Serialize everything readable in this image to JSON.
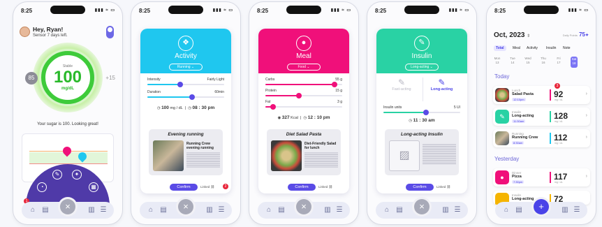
{
  "status": {
    "time": "8:25",
    "signal": "▮▮▮ ≈ ▭"
  },
  "home": {
    "greeting": "Hey, Ryan!",
    "subtitle": "Sensor 7 days left.",
    "ring_label": "Stable",
    "value": "100",
    "unit": "mg/dL",
    "low": "85",
    "delta": "+15",
    "message": "Your sugar is 100. Looking great!",
    "badge": "1"
  },
  "activity": {
    "title": "Activity",
    "type": "Running",
    "color": "#1fc7ef",
    "sliders": [
      {
        "name": "Intensity",
        "value": "Fairly Light",
        "pct": 0.43
      },
      {
        "name": "Duration",
        "value": "60min",
        "pct": 0.58
      }
    ],
    "stat_value": "100",
    "stat_unit": "mg / dL",
    "time": "08 : 30 pm",
    "post_title": "Evening running",
    "post_heading": "Running Crew evening running",
    "confirm": "Confirm",
    "linked": "Linked",
    "linked_count": "2"
  },
  "meal": {
    "title": "Meal",
    "type": "Food",
    "color": "#f0107a",
    "sliders": [
      {
        "name": "Carbs",
        "value": "55 g",
        "pct": 0.9
      },
      {
        "name": "Protein",
        "value": "15 g",
        "pct": 0.44
      },
      {
        "name": "Fat",
        "value": "3 g",
        "pct": 0.1
      }
    ],
    "stat_value": "327",
    "stat_unit": "Kcal",
    "time": "12 : 10 pm",
    "post_title": "Diet Salad Pasta",
    "post_heading": "Diet-Friendly Salad for lunch",
    "confirm": "Confirm",
    "linked": "Linked"
  },
  "insulin": {
    "title": "Insulin",
    "type": "Long-acting",
    "color": "#29d2a4",
    "opt_fast": "Fast-acting",
    "opt_long": "Long-acting",
    "units_label": "Insulin units",
    "units_value": "5 UI",
    "units_pct": 0.55,
    "time": "11 : 30 am",
    "post_title": "Long-acting Insulin",
    "confirm": "Confirm",
    "linked": "Linked"
  },
  "log": {
    "month": "Oct, 2023",
    "points": "75",
    "points_label": "Daily Points",
    "filters": [
      "Total",
      "Meal",
      "Activity",
      "Insulin",
      "Note"
    ],
    "days": [
      {
        "dow": "Mon",
        "num": "13"
      },
      {
        "dow": "Tue",
        "num": "14"
      },
      {
        "dow": "Wed",
        "num": "15"
      },
      {
        "dow": "Thu",
        "num": "16"
      },
      {
        "dow": "Fri",
        "num": "17"
      },
      {
        "dow": "Sat",
        "num": "18"
      }
    ],
    "today": "Today",
    "yesterday": "Yesterday",
    "entries": [
      {
        "cat": "Lunch",
        "name": "Salad Pasta",
        "time": "12:10pm",
        "value": "92",
        "unit": "mg / dL",
        "color": "#f0107a",
        "badge": "3"
      },
      {
        "cat": "Insulin",
        "name": "Long-acting",
        "time": "11:30am",
        "value": "128",
        "unit": "mg / dL",
        "color": "#29d2a4"
      },
      {
        "cat": "Running",
        "name": "Running Crew",
        "time": "8:30am",
        "value": "112",
        "unit": "mg / dL",
        "color": "#1fc7ef"
      },
      {
        "cat": "Dinner",
        "name": "Pizza",
        "time": "7:30pm",
        "value": "117",
        "unit": "mg / dL",
        "color": "#f0107a"
      },
      {
        "cat": "Insulin",
        "name": "Long-acting",
        "time": "",
        "value": "72",
        "unit": "",
        "color": "#f5b400"
      }
    ]
  },
  "nav": {
    "close": "×",
    "add": "+"
  }
}
